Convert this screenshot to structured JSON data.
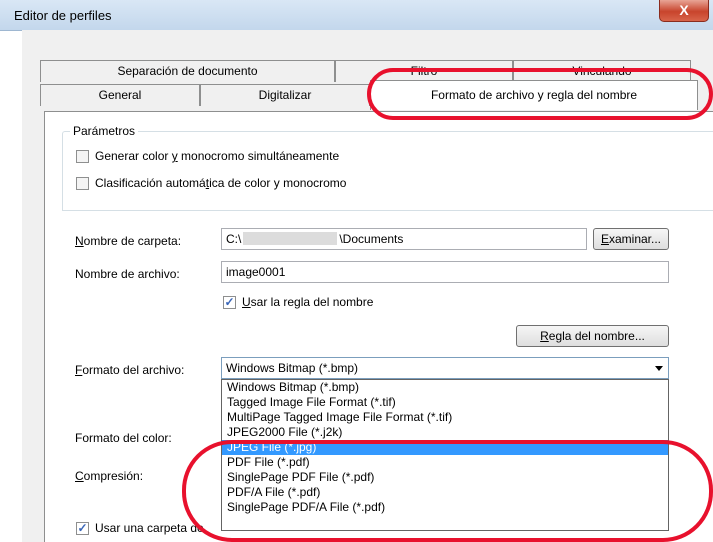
{
  "window": {
    "title": "Editor de perfiles",
    "close_glyph": "X"
  },
  "tabs_back": [
    "Separación de documento",
    "Filtro",
    "Vinculando"
  ],
  "tabs_front": [
    "General",
    "Digitalizar",
    "Formato de archivo y regla del nombre"
  ],
  "params": {
    "group_label": "Parámetros",
    "chk1": {
      "pre": "Generar color ",
      "u": "y",
      "post": " monocromo simultáneamente",
      "checked": false
    },
    "chk2": {
      "pre": "Clasificación automá",
      "u": "t",
      "post": "ica de color y monocromo",
      "checked": false
    }
  },
  "folder": {
    "label_u": "N",
    "label_rest": "ombre de carpeta:",
    "value_pre": "C:\\",
    "value_post": "\\Documents",
    "browse_u": "E",
    "browse_rest": "xaminar..."
  },
  "file": {
    "label": "Nombre de archivo:",
    "value": "image0001"
  },
  "use_rule": {
    "pre": "",
    "u": "U",
    "post": "sar la regla del nombre",
    "checked": true
  },
  "rule_button": {
    "u": "R",
    "rest": "egla del nombre..."
  },
  "format": {
    "label_u": "F",
    "label_rest": "ormato del archivo:",
    "selected": "Windows Bitmap (*.bmp)",
    "options": [
      "Windows Bitmap (*.bmp)",
      "Tagged Image File Format (*.tif)",
      "MultiPage Tagged Image File Format (*.tif)",
      "JPEG2000 File (*.j2k)",
      "JPEG File (*.jpg)",
      "PDF File (*.pdf)",
      "SinglePage PDF File (*.pdf)",
      "PDF/A File (*.pdf)",
      "SinglePage PDF/A File (*.pdf)"
    ],
    "highlighted_index": 4
  },
  "color_format": {
    "label": "Formato del color:"
  },
  "compression": {
    "label_u": "C",
    "label_rest": "ompresión:"
  },
  "use_folder": {
    "label": "Usar una carpeta de",
    "checked": true
  },
  "annotation_color": "#e8112d",
  "highlight_color": "#3399ff"
}
